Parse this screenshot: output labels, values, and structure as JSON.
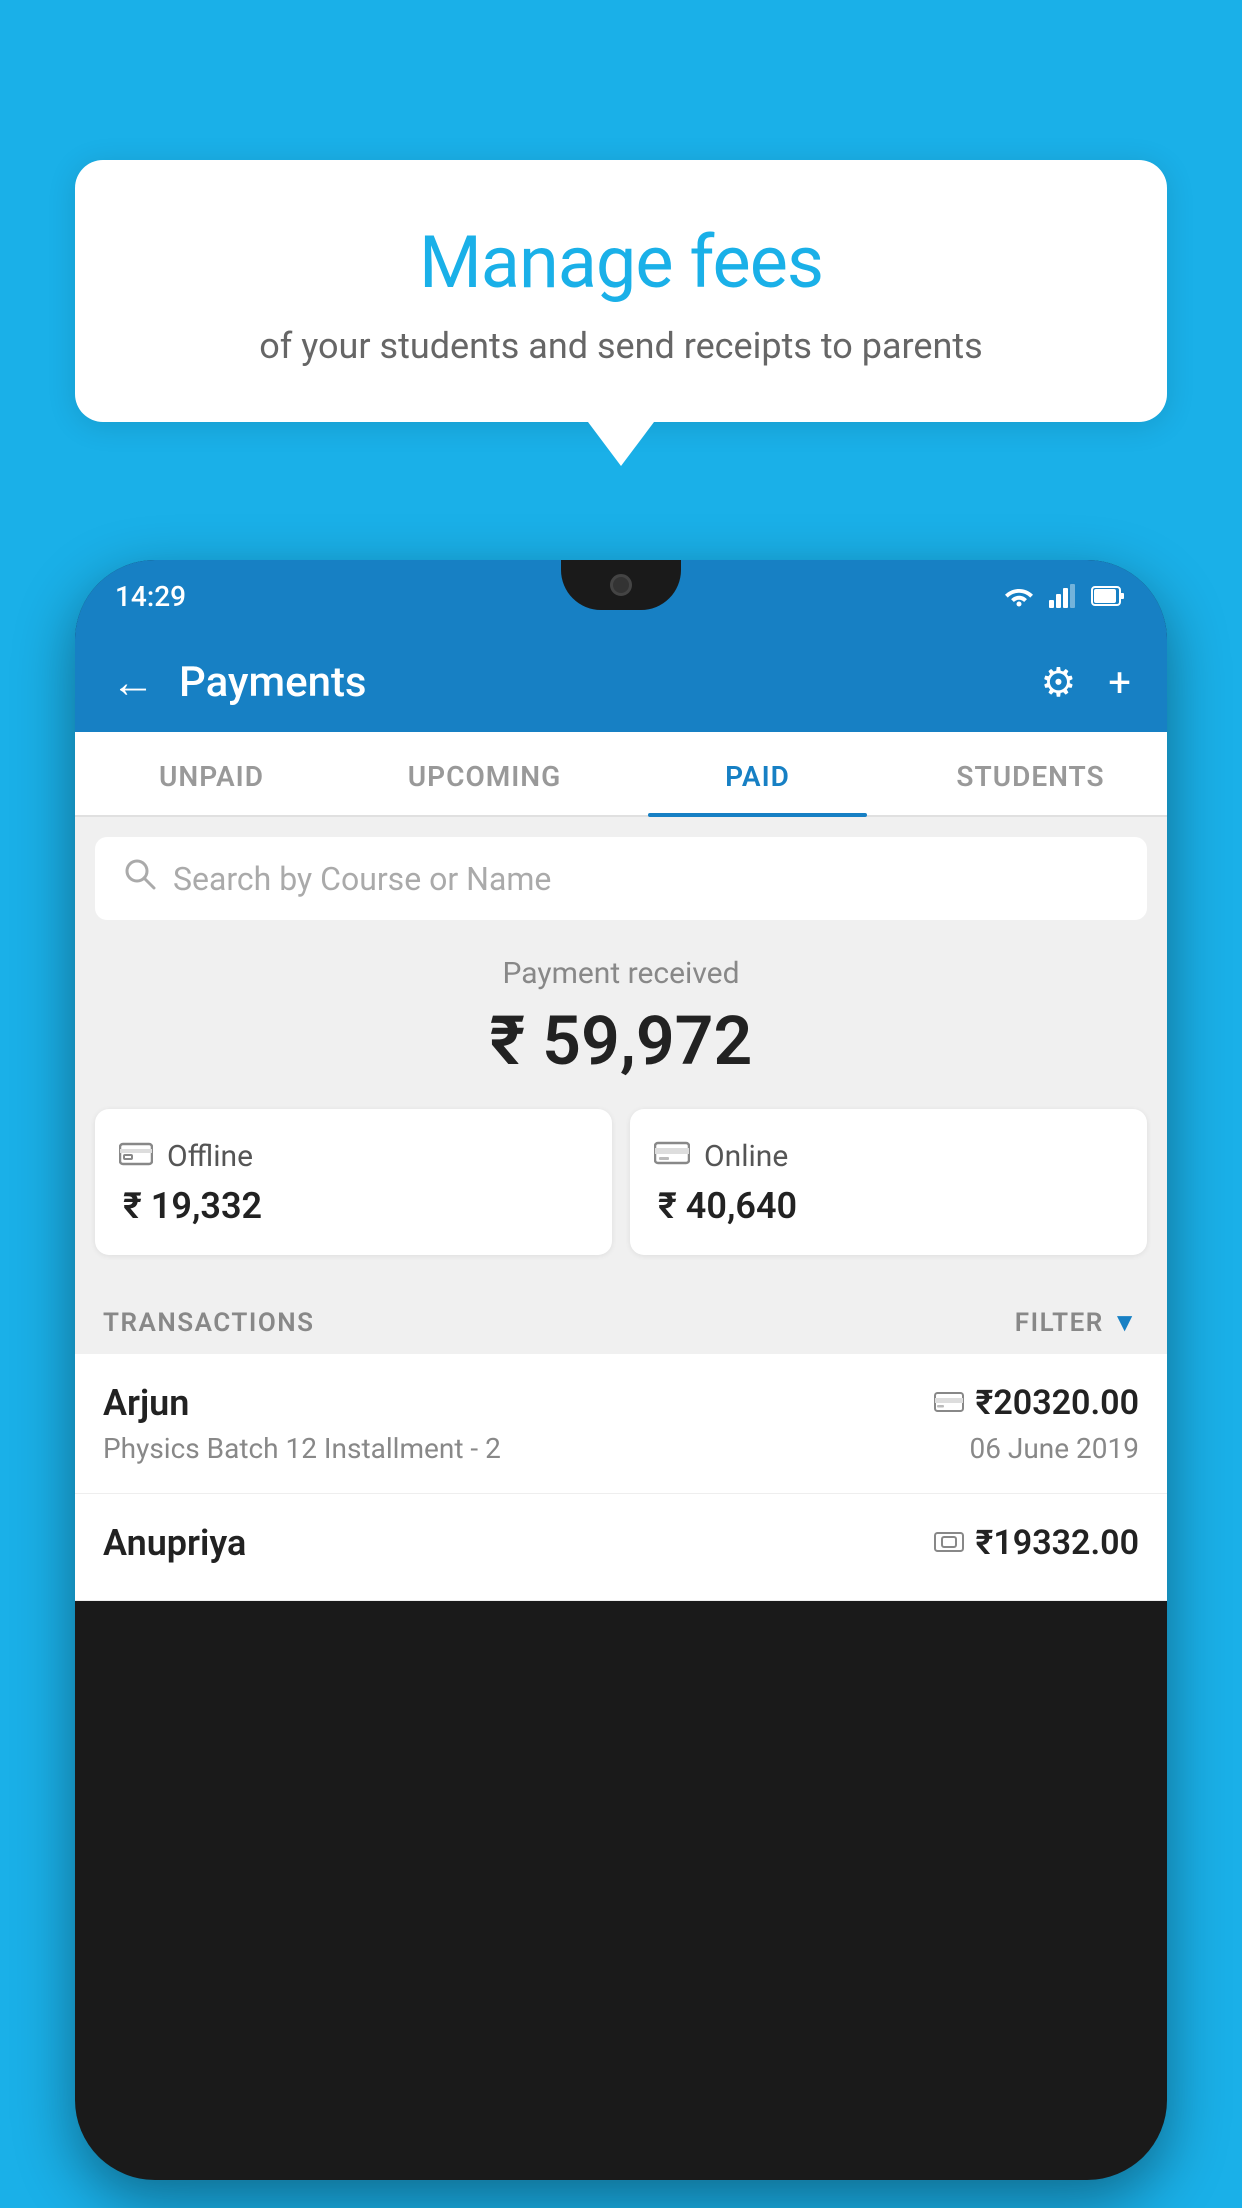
{
  "background_color": "#1ab0e8",
  "bubble": {
    "title": "Manage fees",
    "subtitle": "of your students and send receipts to parents"
  },
  "phone": {
    "status_bar": {
      "time": "14:29",
      "icons": [
        "wifi",
        "signal",
        "battery"
      ]
    },
    "header": {
      "title": "Payments",
      "back_label": "←",
      "settings_icon": "⚙",
      "add_icon": "+"
    },
    "tabs": [
      {
        "label": "UNPAID",
        "active": false
      },
      {
        "label": "UPCOMING",
        "active": false
      },
      {
        "label": "PAID",
        "active": true
      },
      {
        "label": "STUDENTS",
        "active": false
      }
    ],
    "search": {
      "placeholder": "Search by Course or Name"
    },
    "payment_summary": {
      "label": "Payment received",
      "amount": "₹ 59,972"
    },
    "payment_cards": [
      {
        "type": "Offline",
        "amount": "₹ 19,332",
        "icon": "cash"
      },
      {
        "type": "Online",
        "amount": "₹ 40,640",
        "icon": "card"
      }
    ],
    "transactions_section": {
      "label": "TRANSACTIONS",
      "filter_label": "FILTER"
    },
    "transactions": [
      {
        "name": "Arjun",
        "course": "Physics Batch 12 Installment - 2",
        "amount": "₹20320.00",
        "date": "06 June 2019",
        "mode_icon": "card"
      },
      {
        "name": "Anupriya",
        "course": "",
        "amount": "₹19332.00",
        "date": "",
        "mode_icon": "cash"
      }
    ]
  }
}
